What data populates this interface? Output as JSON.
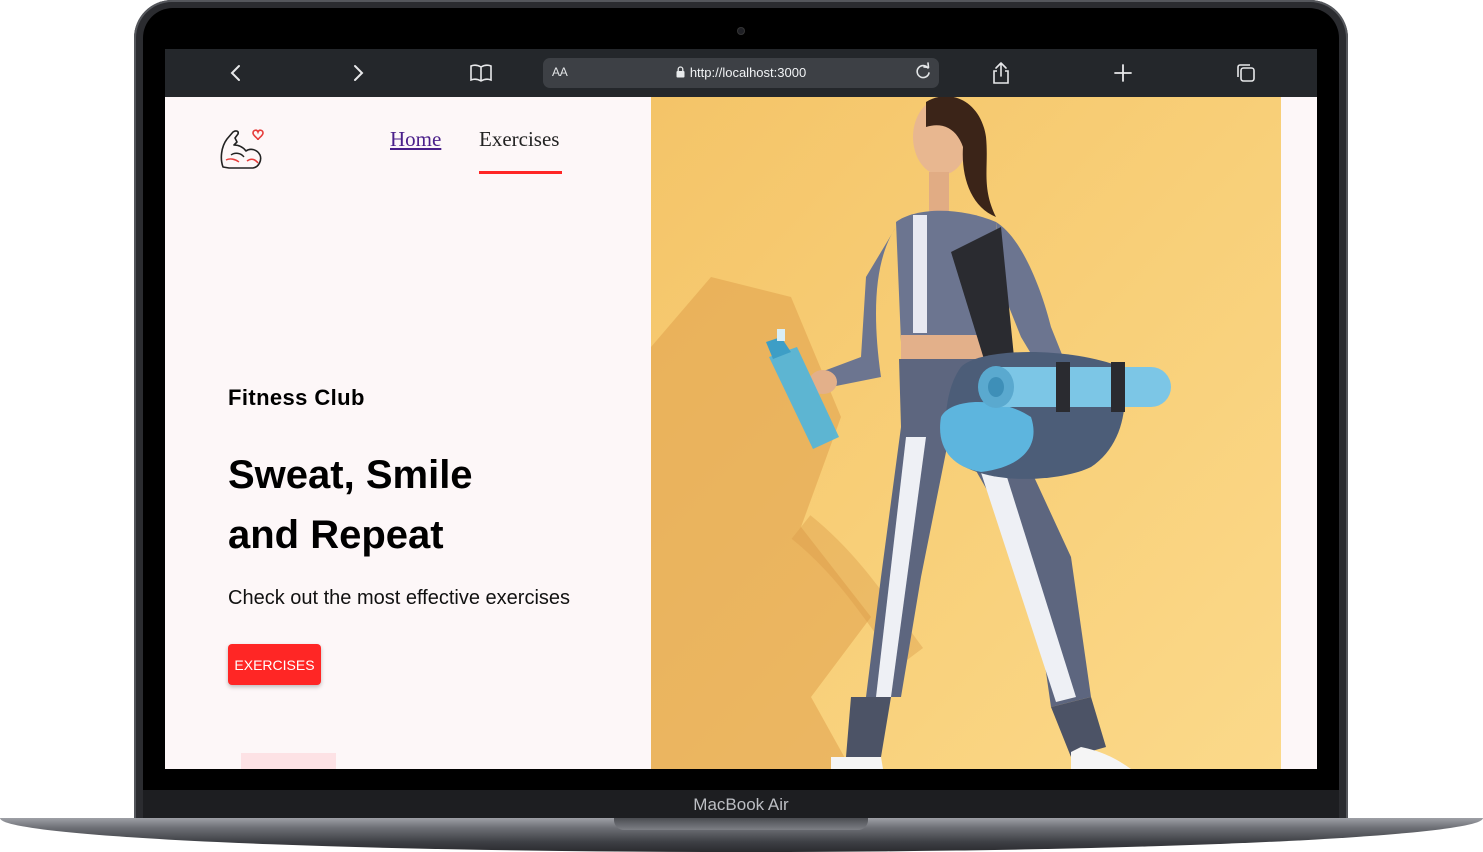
{
  "device": {
    "label": "MacBook Air"
  },
  "browser": {
    "text_size_label": "AA",
    "url": "http://localhost:3000",
    "icons": [
      "back-icon",
      "forward-icon",
      "bookmarks-icon",
      "lock-icon",
      "reload-icon",
      "share-icon",
      "new-tab-icon",
      "tabs-icon"
    ]
  },
  "nav": {
    "links": [
      {
        "label": "Home",
        "active": false
      },
      {
        "label": "Exercises",
        "active": true
      }
    ],
    "logo_icon": "flexed-arm-heart-icon"
  },
  "hero": {
    "subtitle": "Fitness Club",
    "title_line1": "Sweat, Smile",
    "title_line2": "and Repeat",
    "description": "Check out the most effective exercises",
    "cta_label": "EXERCISES",
    "image_alt": "woman walking with gym bag, yoga mat and shaker bottle"
  },
  "colors": {
    "accent": "#ff2625",
    "page_bg": "#fdf7f8",
    "image_bg": "#f7c86a",
    "browser_bar": "#24272b"
  }
}
